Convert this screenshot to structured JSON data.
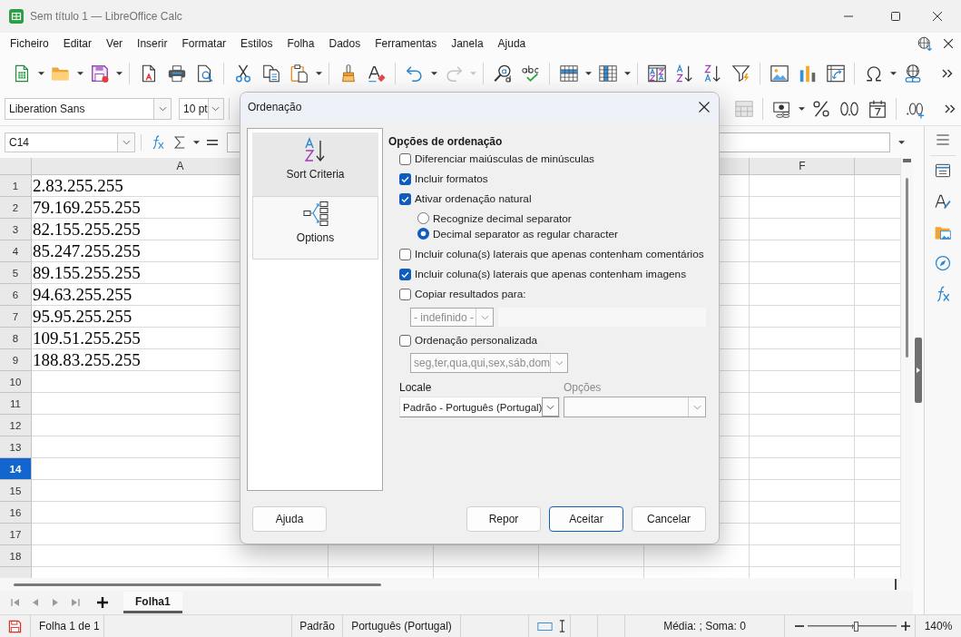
{
  "window": {
    "title": "Sem título 1 — LibreOffice Calc"
  },
  "menu": [
    "Ficheiro",
    "Editar",
    "Ver",
    "Inserir",
    "Formatar",
    "Estilos",
    "Folha",
    "Dados",
    "Ferramentas",
    "Janela",
    "Ajuda"
  ],
  "formatting_bar": {
    "font_name": "Liberation Sans",
    "font_size": "10 pt"
  },
  "formula_bar": {
    "name_box": "C14"
  },
  "sheet": {
    "columns": [
      {
        "label": "A"
      },
      {
        "label": "F"
      }
    ],
    "rows": [
      {
        "number": "1",
        "value": "2.83.255.255",
        "selected": false
      },
      {
        "number": "2",
        "value": "79.169.255.255",
        "selected": false
      },
      {
        "number": "3",
        "value": "82.155.255.255",
        "selected": false
      },
      {
        "number": "4",
        "value": "85.247.255.255",
        "selected": false
      },
      {
        "number": "5",
        "value": "89.155.255.255",
        "selected": false
      },
      {
        "number": "6",
        "value": "94.63.255.255",
        "selected": false
      },
      {
        "number": "7",
        "value": "95.95.255.255",
        "selected": false
      },
      {
        "number": "8",
        "value": "109.51.255.255",
        "selected": false
      },
      {
        "number": "9",
        "value": "188.83.255.255",
        "selected": false
      },
      {
        "number": "10",
        "selected": false
      },
      {
        "number": "11",
        "selected": false
      },
      {
        "number": "12",
        "selected": false
      },
      {
        "number": "13",
        "selected": false
      },
      {
        "number": "14",
        "selected": true
      },
      {
        "number": "15",
        "selected": false
      },
      {
        "number": "16",
        "selected": false
      },
      {
        "number": "17",
        "selected": false
      },
      {
        "number": "18",
        "selected": false
      }
    ]
  },
  "sheet_tabs": [
    {
      "label": "Folha1",
      "selected": true
    }
  ],
  "status_bar": {
    "sheet": "Folha 1 de 1",
    "page_style": "Padrão",
    "language": "Português (Portugal)",
    "summary": "Média: ; Soma: 0",
    "zoom": {
      "level": 0.55,
      "reading": "140%"
    }
  },
  "dialog": {
    "title": "Ordenação",
    "pages": [
      {
        "label": "Sort Criteria",
        "selected": false
      },
      {
        "label": "Options",
        "selected": true
      }
    ],
    "section_title": "Opções de ordenação",
    "options": [
      {
        "kind": "check",
        "label": "Diferenciar maiúsculas de minúsculas",
        "checked": false
      },
      {
        "kind": "check",
        "label": "Incluir formatos",
        "checked": true
      },
      {
        "kind": "check-radios",
        "label": "Ativar ordenação natural",
        "checked": true,
        "radios": [
          {
            "label": "Recognize decimal separator",
            "selected": false
          },
          {
            "label": "Decimal separator as regular character",
            "selected": true
          }
        ]
      },
      {
        "kind": "check",
        "label": "Incluir coluna(s) laterais que apenas contenham comentários",
        "checked": false
      },
      {
        "kind": "check",
        "label": "Incluir coluna(s) laterais que apenas contenham imagens",
        "checked": true
      },
      {
        "kind": "check-target",
        "label": "Copiar resultados para:",
        "checked": false,
        "dropdown": "- indefinido -"
      },
      {
        "kind": "check-list",
        "label": "Ordenação personalizada",
        "checked": false,
        "dropdown": "seg,ter,qua,qui,sex,sáb,dom"
      }
    ],
    "locale": {
      "label": "Locale",
      "value": "Padrão - Português (Portugal)"
    },
    "locale_options": {
      "label": "Opções",
      "disabled": true
    },
    "help_button": "Ajuda",
    "buttons": [
      {
        "label": "Repor",
        "default": false
      },
      {
        "label": "Aceitar",
        "default": true
      },
      {
        "label": "Cancelar",
        "default": false
      }
    ]
  }
}
